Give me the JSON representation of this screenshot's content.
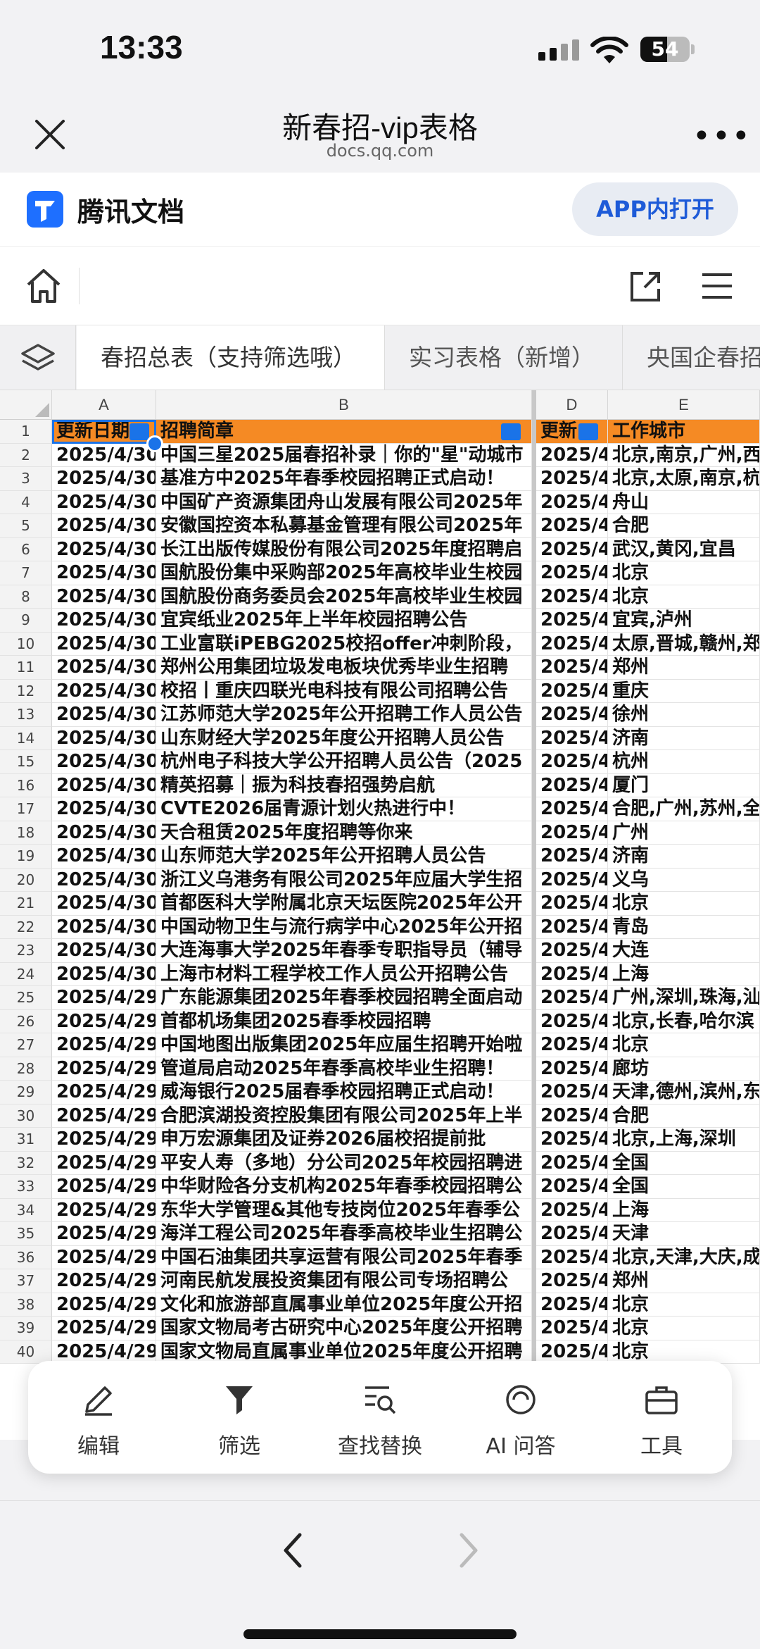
{
  "status": {
    "time": "13:33",
    "battery": "54"
  },
  "nav": {
    "title": "新春招-vip表格",
    "url": "docs.qq.com"
  },
  "app": {
    "brand": "腾讯文档",
    "open_button": "APP内打开"
  },
  "sheet_tabs": [
    "春招总表（支持筛选哦）",
    "实习表格（新增）",
    "央国企春招"
  ],
  "columns": [
    "A",
    "B",
    "D",
    "E"
  ],
  "header_row": {
    "a": "更新日期",
    "b": "招聘简章",
    "d": "更新",
    "e": "工作城市"
  },
  "rows": [
    {
      "n": "2",
      "a": "2025/4/30",
      "b": "中国三星2025届春招补录｜你的\"星\"动城市",
      "d": "2025/4/",
      "e": "北京,南京,广州,西"
    },
    {
      "n": "3",
      "a": "2025/4/30",
      "b": "基准方中2025年春季校园招聘正式启动！",
      "d": "2025/4/",
      "e": "北京,太原,南京,杭"
    },
    {
      "n": "4",
      "a": "2025/4/30",
      "b": "中国矿产资源集团舟山发展有限公司2025年",
      "d": "2025/4/",
      "e": "舟山"
    },
    {
      "n": "5",
      "a": "2025/4/30",
      "b": "安徽国控资本私募基金管理有限公司2025年",
      "d": "2025/4/",
      "e": "合肥"
    },
    {
      "n": "6",
      "a": "2025/4/30",
      "b": "长江出版传媒股份有限公司2025年度招聘启",
      "d": "2025/4/",
      "e": "武汉,黄冈,宜昌"
    },
    {
      "n": "7",
      "a": "2025/4/30",
      "b": "国航股份集中采购部2025年高校毕业生校园",
      "d": "2025/4/",
      "e": "北京"
    },
    {
      "n": "8",
      "a": "2025/4/30",
      "b": "国航股份商务委员会2025年高校毕业生校园",
      "d": "2025/4/",
      "e": "北京"
    },
    {
      "n": "9",
      "a": "2025/4/30",
      "b": "宜宾纸业2025年上半年校园招聘公告",
      "d": "2025/4/",
      "e": "宜宾,泸州"
    },
    {
      "n": "10",
      "a": "2025/4/30",
      "b": "工业富联iPEBG2025校招offer冲刺阶段，",
      "d": "2025/4/",
      "e": "太原,晋城,赣州,郑"
    },
    {
      "n": "11",
      "a": "2025/4/30",
      "b": "郑州公用集团垃圾发电板块优秀毕业生招聘",
      "d": "2025/4/",
      "e": "郑州"
    },
    {
      "n": "12",
      "a": "2025/4/30",
      "b": "校招丨重庆四联光电科技有限公司招聘公告",
      "d": "2025/4/",
      "e": "重庆"
    },
    {
      "n": "13",
      "a": "2025/4/30",
      "b": "江苏师范大学2025年公开招聘工作人员公告",
      "d": "2025/4/",
      "e": "徐州"
    },
    {
      "n": "14",
      "a": "2025/4/30",
      "b": "山东财经大学2025年度公开招聘人员公告",
      "d": "2025/4/",
      "e": "济南"
    },
    {
      "n": "15",
      "a": "2025/4/30",
      "b": "杭州电子科技大学公开招聘人员公告（2025",
      "d": "2025/4/",
      "e": "杭州"
    },
    {
      "n": "16",
      "a": "2025/4/30",
      "b": "精英招募｜振为科技春招强势启航",
      "d": "2025/4/",
      "e": "厦门"
    },
    {
      "n": "17",
      "a": "2025/4/30",
      "b": "CVTE2026届青源计划火热进行中！",
      "d": "2025/4/",
      "e": "合肥,广州,苏州,全"
    },
    {
      "n": "18",
      "a": "2025/4/30",
      "b": "天合租赁2025年度招聘等你来",
      "d": "2025/4/",
      "e": "广州"
    },
    {
      "n": "19",
      "a": "2025/4/30",
      "b": "山东师范大学2025年公开招聘人员公告",
      "d": "2025/4/",
      "e": "济南"
    },
    {
      "n": "20",
      "a": "2025/4/30",
      "b": "浙江义乌港务有限公司2025年应届大学生招",
      "d": "2025/4/",
      "e": "义乌"
    },
    {
      "n": "21",
      "a": "2025/4/30",
      "b": "首都医科大学附属北京天坛医院2025年公开",
      "d": "2025/4/",
      "e": "北京"
    },
    {
      "n": "22",
      "a": "2025/4/30",
      "b": "中国动物卫生与流行病学中心2025年公开招",
      "d": "2025/4/",
      "e": "青岛"
    },
    {
      "n": "23",
      "a": "2025/4/30",
      "b": "大连海事大学2025年春季专职指导员（辅导",
      "d": "2025/4/",
      "e": "大连"
    },
    {
      "n": "24",
      "a": "2025/4/30",
      "b": "上海市材料工程学校工作人员公开招聘公告",
      "d": "2025/4/",
      "e": "上海"
    },
    {
      "n": "25",
      "a": "2025/4/29",
      "b": "广东能源集团2025年春季校园招聘全面启动",
      "d": "2025/4/",
      "e": "广州,深圳,珠海,汕"
    },
    {
      "n": "26",
      "a": "2025/4/29",
      "b": "首都机场集团2025春季校园招聘",
      "d": "2025/4/",
      "e": "北京,长春,哈尔滨"
    },
    {
      "n": "27",
      "a": "2025/4/29",
      "b": "中国地图出版集团2025年应届生招聘开始啦",
      "d": "2025/4/",
      "e": "北京"
    },
    {
      "n": "28",
      "a": "2025/4/29",
      "b": "管道局启动2025年春季高校毕业生招聘！",
      "d": "2025/4/",
      "e": "廊坊"
    },
    {
      "n": "29",
      "a": "2025/4/29",
      "b": "威海银行2025届春季校园招聘正式启动！",
      "d": "2025/4/",
      "e": "天津,德州,滨州,东"
    },
    {
      "n": "30",
      "a": "2025/4/29",
      "b": "合肥滨湖投资控股集团有限公司2025年上半",
      "d": "2025/4/",
      "e": "合肥"
    },
    {
      "n": "31",
      "a": "2025/4/29",
      "b": "申万宏源集团及证券2026届校招提前批",
      "d": "2025/4/",
      "e": "北京,上海,深圳"
    },
    {
      "n": "32",
      "a": "2025/4/29",
      "b": "平安人寿（多地）分公司2025年校园招聘进",
      "d": "2025/4/",
      "e": "全国"
    },
    {
      "n": "33",
      "a": "2025/4/29",
      "b": "中华财险各分支机构2025年春季校园招聘公",
      "d": "2025/4/",
      "e": "全国"
    },
    {
      "n": "34",
      "a": "2025/4/29",
      "b": "东华大学管理&其他专技岗位2025年春季公",
      "d": "2025/4/",
      "e": "上海"
    },
    {
      "n": "35",
      "a": "2025/4/29",
      "b": "海洋工程公司2025年春季高校毕业生招聘公",
      "d": "2025/4/",
      "e": "天津"
    },
    {
      "n": "36",
      "a": "2025/4/29",
      "b": "中国石油集团共享运营有限公司2025年春季",
      "d": "2025/4/",
      "e": "北京,天津,大庆,成"
    },
    {
      "n": "37",
      "a": "2025/4/29",
      "b": "河南民航发展投资集团有限公司专场招聘公",
      "d": "2025/4/",
      "e": "郑州"
    },
    {
      "n": "38",
      "a": "2025/4/29",
      "b": "文化和旅游部直属事业单位2025年度公开招",
      "d": "2025/4/",
      "e": "北京"
    },
    {
      "n": "39",
      "a": "2025/4/29",
      "b": "国家文物局考古研究中心2025年度公开招聘",
      "d": "2025/4/",
      "e": "北京"
    },
    {
      "n": "40",
      "a": "2025/4/29",
      "b": "国家文物局直属事业单位2025年度公开招聘",
      "d": "2025/4/",
      "e": "北京"
    }
  ],
  "bottom_actions": [
    {
      "label": "编辑",
      "icon": "pencil-icon"
    },
    {
      "label": "筛选",
      "icon": "filter-icon"
    },
    {
      "label": "查找替换",
      "icon": "find-replace-icon"
    },
    {
      "label": "AI 问答",
      "icon": "ai-chat-icon"
    },
    {
      "label": "工具",
      "icon": "toolbox-icon"
    }
  ],
  "colors": {
    "header_fill": "#f58a24",
    "accent": "#1a73e8",
    "brand": "#1e6fff"
  }
}
